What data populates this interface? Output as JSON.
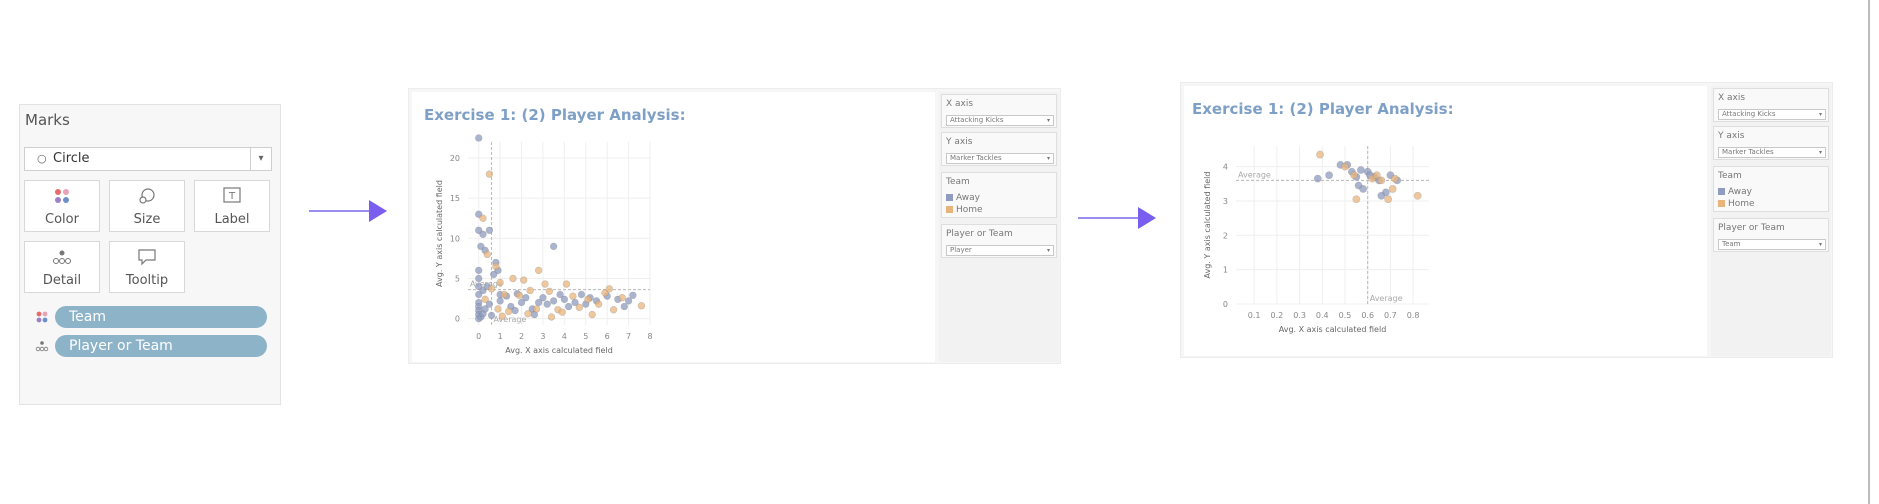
{
  "marks_card": {
    "title": "Marks",
    "mark_type": "Circle",
    "buttons": {
      "color": "Color",
      "size": "Size",
      "label": "Label",
      "detail": "Detail",
      "tooltip": "Tooltip"
    },
    "pills": [
      {
        "label": "Team",
        "icon": "color-dots-icon"
      },
      {
        "label": "Player or Team",
        "icon": "detail-dots-icon"
      }
    ],
    "colors": {
      "pill": "#8db3c9",
      "dot_red": "#e86a6a",
      "dot_blue": "#6f8fc9",
      "dot_pink": "#e9a3b6",
      "dot_purple": "#9a7fc9"
    }
  },
  "arrow_color": "#7a5ef0",
  "dashboard1": {
    "title": "Exercise 1: (2) Player Analysis:",
    "controls": {
      "x_axis": {
        "label": "X axis",
        "value": "Attacking Kicks"
      },
      "y_axis": {
        "label": "Y axis",
        "value": "Marker Tackles"
      },
      "team": {
        "label": "Team",
        "items": [
          "Away",
          "Home"
        ]
      },
      "player_or_team": {
        "label": "Player or Team",
        "value": "Player"
      }
    }
  },
  "dashboard2": {
    "title": "Exercise 1: (2) Player Analysis:",
    "controls": {
      "x_axis": {
        "label": "X axis",
        "value": "Attacking Kicks"
      },
      "y_axis": {
        "label": "Y axis",
        "value": "Marker Tackles"
      },
      "team": {
        "label": "Team",
        "items": [
          "Away",
          "Home"
        ]
      },
      "player_or_team": {
        "label": "Player or Team",
        "value": "Team"
      }
    }
  },
  "chart_data": [
    {
      "type": "scatter",
      "xlabel": "Avg. X axis calculated field",
      "ylabel": "Avg. Y axis calculated field",
      "xlim": [
        -0.5,
        8
      ],
      "ylim": [
        -0.8,
        22
      ],
      "xticks": [
        0,
        1,
        2,
        3,
        4,
        5,
        6,
        7,
        8
      ],
      "yticks": [
        0,
        5,
        10,
        15,
        20
      ],
      "reference_lines": {
        "x": 0.6,
        "y": 3.6,
        "label": "Average"
      },
      "colors": {
        "Away": "#8f9bbf",
        "Home": "#e8b47c"
      },
      "series": [
        {
          "name": "Away",
          "points": [
            [
              0,
              22.5
            ],
            [
              0,
              13
            ],
            [
              0,
              11
            ],
            [
              0.2,
              10.5
            ],
            [
              0.1,
              9
            ],
            [
              0.3,
              8.5
            ],
            [
              0.5,
              11
            ],
            [
              0.8,
              7
            ],
            [
              0.9,
              6
            ],
            [
              0.7,
              5.5
            ],
            [
              0.4,
              4
            ],
            [
              0.2,
              3.5
            ],
            [
              0,
              6
            ],
            [
              0,
              5
            ],
            [
              0,
              4
            ],
            [
              0,
              3
            ],
            [
              0,
              2
            ],
            [
              0,
              1.5
            ],
            [
              0,
              1
            ],
            [
              0,
              0.5
            ],
            [
              0,
              0
            ],
            [
              0.1,
              0.2
            ],
            [
              0.2,
              0.6
            ],
            [
              0.3,
              1.2
            ],
            [
              0.5,
              1.8
            ],
            [
              1,
              2.2
            ],
            [
              1.3,
              2.8
            ],
            [
              1.5,
              1.5
            ],
            [
              1.7,
              1
            ],
            [
              2,
              2
            ],
            [
              2.2,
              2.6
            ],
            [
              2.5,
              1.2
            ],
            [
              2.8,
              2
            ],
            [
              3,
              2.6
            ],
            [
              3.2,
              1.8
            ],
            [
              3.5,
              2.2
            ],
            [
              3.8,
              3
            ],
            [
              4,
              2.4
            ],
            [
              4.2,
              1.5
            ],
            [
              4.5,
              2
            ],
            [
              4.8,
              3
            ],
            [
              5,
              1.8
            ],
            [
              5.2,
              2.6
            ],
            [
              5.5,
              2.2
            ],
            [
              6,
              2.8
            ],
            [
              6.5,
              2.4
            ],
            [
              7,
              2.2
            ],
            [
              7.2,
              2.9
            ],
            [
              3.5,
              9
            ],
            [
              1,
              3
            ],
            [
              0.6,
              0.4
            ],
            [
              1.8,
              3.1
            ],
            [
              2.6,
              0.5
            ],
            [
              6.8,
              1.5
            ]
          ]
        },
        {
          "name": "Home",
          "points": [
            [
              0.5,
              18
            ],
            [
              0.2,
              12.5
            ],
            [
              0.4,
              8
            ],
            [
              0.8,
              6.5
            ],
            [
              1,
              4.5
            ],
            [
              1.2,
              3
            ],
            [
              1.6,
              5
            ],
            [
              2.1,
              4.8
            ],
            [
              2.8,
              6
            ],
            [
              3.1,
              4.3
            ],
            [
              1.4,
              0.9
            ],
            [
              2.3,
              0.6
            ],
            [
              2.7,
              1.2
            ],
            [
              3.4,
              0.2
            ],
            [
              3.3,
              3.4
            ],
            [
              3.7,
              1.1
            ],
            [
              4.1,
              4.3
            ],
            [
              4.4,
              2.8
            ],
            [
              4.7,
              1.4
            ],
            [
              5.1,
              2.4
            ],
            [
              5.6,
              1.8
            ],
            [
              5.9,
              3.2
            ],
            [
              6.1,
              3.7
            ],
            [
              6.3,
              1.1
            ],
            [
              6.7,
              2.6
            ],
            [
              7.6,
              1.6
            ],
            [
              0.3,
              2.4
            ],
            [
              0.6,
              3.7
            ],
            [
              0.9,
              1.2
            ],
            [
              1.1,
              0.3
            ],
            [
              1.9,
              2.9
            ],
            [
              2.4,
              3.5
            ],
            [
              3.9,
              0.8
            ],
            [
              5.3,
              0.5
            ]
          ]
        }
      ]
    },
    {
      "type": "scatter",
      "xlabel": "Avg. X axis calculated field",
      "ylabel": "Avg. Y axis calculated field",
      "xlim": [
        0.02,
        0.87
      ],
      "ylim": [
        0,
        4.6
      ],
      "xticks": [
        0.1,
        0.2,
        0.3,
        0.4,
        0.5,
        0.6,
        0.7,
        0.8
      ],
      "yticks": [
        0,
        1,
        2,
        3,
        4
      ],
      "reference_lines": {
        "x": 0.6,
        "y": 3.6,
        "label": "Average"
      },
      "colors": {
        "Away": "#8f9bbf",
        "Home": "#e8b47c"
      },
      "series": [
        {
          "name": "Away",
          "points": [
            [
              0.38,
              3.65
            ],
            [
              0.43,
              3.75
            ],
            [
              0.48,
              4.05
            ],
            [
              0.51,
              4.05
            ],
            [
              0.53,
              3.85
            ],
            [
              0.55,
              3.7
            ],
            [
              0.56,
              3.45
            ],
            [
              0.58,
              3.35
            ],
            [
              0.6,
              3.85
            ],
            [
              0.63,
              3.7
            ],
            [
              0.65,
              3.6
            ],
            [
              0.68,
              3.25
            ],
            [
              0.7,
              3.75
            ],
            [
              0.73,
              3.6
            ],
            [
              0.66,
              3.15
            ],
            [
              0.57,
              3.9
            ],
            [
              0.61,
              3.75
            ]
          ]
        },
        {
          "name": "Home",
          "points": [
            [
              0.39,
              4.35
            ],
            [
              0.5,
              4.0
            ],
            [
              0.54,
              3.75
            ],
            [
              0.55,
              3.05
            ],
            [
              0.62,
              3.65
            ],
            [
              0.66,
              3.6
            ],
            [
              0.69,
              3.05
            ],
            [
              0.71,
              3.35
            ],
            [
              0.72,
              3.65
            ],
            [
              0.82,
              3.15
            ],
            [
              0.64,
              3.75
            ]
          ]
        }
      ]
    }
  ]
}
